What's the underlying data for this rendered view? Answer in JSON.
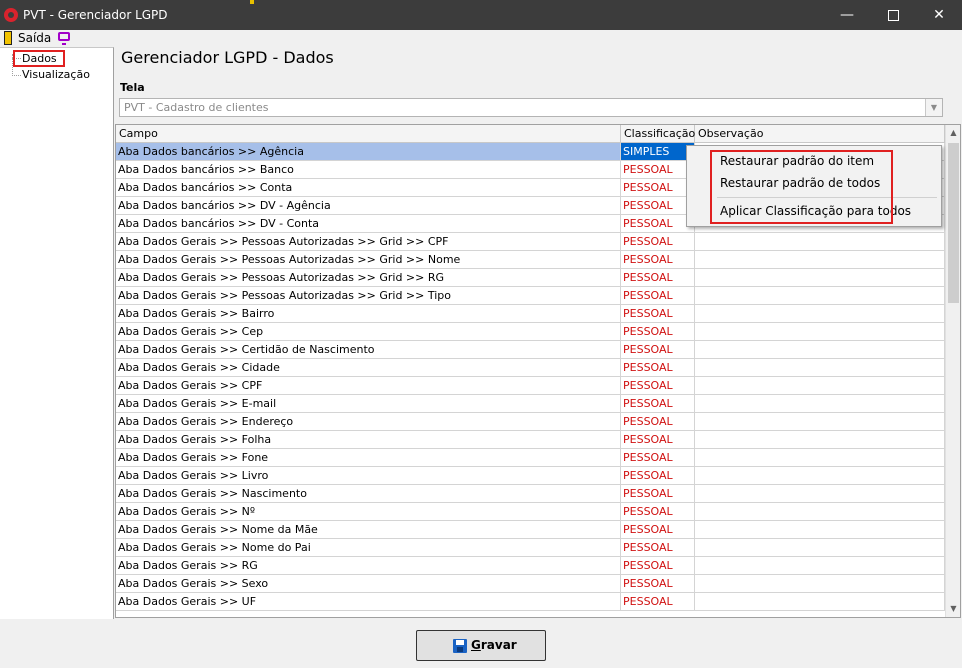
{
  "window": {
    "title": "PVT - Gerenciador LGPD",
    "minimize_glyph": "—",
    "close_glyph": "✕"
  },
  "menu": {
    "exit_label": "Saída",
    "exit_icon": "door-exit-icon",
    "monitor_icon": "monitor-icon"
  },
  "tree": {
    "items": [
      {
        "label": "Dados"
      },
      {
        "label": "Visualização"
      }
    ]
  },
  "page": {
    "title": "Gerenciador LGPD - Dados"
  },
  "tela": {
    "label": "Tela",
    "value": "PVT - Cadastro de clientes",
    "dropdown_glyph": "▼"
  },
  "grid": {
    "headers": [
      "Campo",
      "Classificação",
      "Observação"
    ],
    "selected_index": 0,
    "rows": [
      {
        "campo": "Aba Dados bancários >> Agência",
        "classificacao": "SIMPLES",
        "observacao": ""
      },
      {
        "campo": "Aba Dados bancários >> Banco",
        "classificacao": "PESSOAL",
        "observacao": ""
      },
      {
        "campo": "Aba Dados bancários >> Conta",
        "classificacao": "PESSOAL",
        "observacao": ""
      },
      {
        "campo": "Aba Dados bancários >> DV - Agência",
        "classificacao": "PESSOAL",
        "observacao": ""
      },
      {
        "campo": "Aba Dados bancários >> DV - Conta",
        "classificacao": "PESSOAL",
        "observacao": ""
      },
      {
        "campo": "Aba Dados Gerais >>  Pessoas Autorizadas >> Grid >> CPF",
        "classificacao": "PESSOAL",
        "observacao": ""
      },
      {
        "campo": "Aba Dados Gerais >>  Pessoas Autorizadas >> Grid >> Nome",
        "classificacao": "PESSOAL",
        "observacao": ""
      },
      {
        "campo": "Aba Dados Gerais >>  Pessoas Autorizadas >> Grid >> RG",
        "classificacao": "PESSOAL",
        "observacao": ""
      },
      {
        "campo": "Aba Dados Gerais >>  Pessoas Autorizadas >> Grid >> Tipo",
        "classificacao": "PESSOAL",
        "observacao": ""
      },
      {
        "campo": "Aba Dados Gerais >> Bairro",
        "classificacao": "PESSOAL",
        "observacao": ""
      },
      {
        "campo": "Aba Dados Gerais >> Cep",
        "classificacao": "PESSOAL",
        "observacao": ""
      },
      {
        "campo": "Aba Dados Gerais >> Certidão de Nascimento",
        "classificacao": "PESSOAL",
        "observacao": ""
      },
      {
        "campo": "Aba Dados Gerais >> Cidade",
        "classificacao": "PESSOAL",
        "observacao": ""
      },
      {
        "campo": "Aba Dados Gerais >> CPF",
        "classificacao": "PESSOAL",
        "observacao": ""
      },
      {
        "campo": "Aba Dados Gerais >> E-mail",
        "classificacao": "PESSOAL",
        "observacao": ""
      },
      {
        "campo": "Aba Dados Gerais >> Endereço",
        "classificacao": "PESSOAL",
        "observacao": ""
      },
      {
        "campo": "Aba Dados Gerais >> Folha",
        "classificacao": "PESSOAL",
        "observacao": ""
      },
      {
        "campo": "Aba Dados Gerais >> Fone",
        "classificacao": "PESSOAL",
        "observacao": ""
      },
      {
        "campo": "Aba Dados Gerais >> Livro",
        "classificacao": "PESSOAL",
        "observacao": ""
      },
      {
        "campo": "Aba Dados Gerais >> Nascimento",
        "classificacao": "PESSOAL",
        "observacao": ""
      },
      {
        "campo": "Aba Dados Gerais >> Nº",
        "classificacao": "PESSOAL",
        "observacao": ""
      },
      {
        "campo": "Aba Dados Gerais >> Nome da Mãe",
        "classificacao": "PESSOAL",
        "observacao": ""
      },
      {
        "campo": "Aba Dados Gerais >> Nome do Pai",
        "classificacao": "PESSOAL",
        "observacao": ""
      },
      {
        "campo": "Aba Dados Gerais >> RG",
        "classificacao": "PESSOAL",
        "observacao": ""
      },
      {
        "campo": "Aba Dados Gerais >> Sexo",
        "classificacao": "PESSOAL",
        "observacao": ""
      },
      {
        "campo": "Aba Dados Gerais >> UF",
        "classificacao": "PESSOAL",
        "observacao": ""
      }
    ],
    "scroll_up_glyph": "▲",
    "scroll_down_glyph": "▼"
  },
  "context_menu": {
    "items": [
      "Restaurar padrão do item",
      "Restaurar padrão de todos",
      "Aplicar Classificação para todos"
    ]
  },
  "save_button": {
    "label": "Gravar",
    "icon": "floppy-disk-icon"
  },
  "colors": {
    "titlebar": "#3c3c3c",
    "selection": "#0066cc",
    "selection_row": "#a6bfe9",
    "classification_text": "#d01010",
    "annotation": "#e02020"
  }
}
